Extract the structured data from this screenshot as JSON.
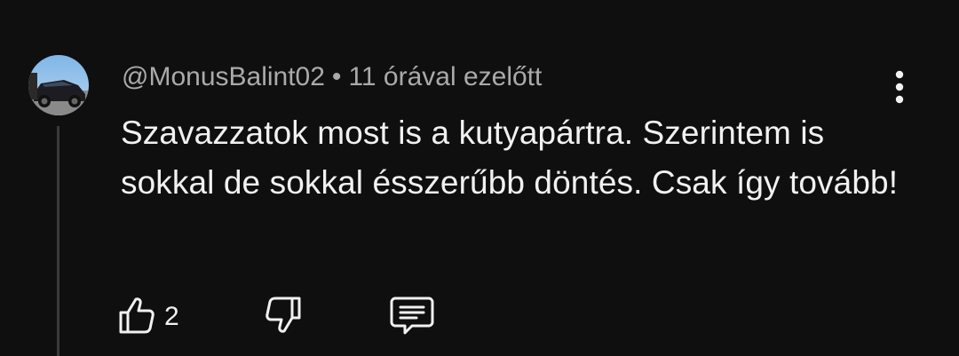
{
  "comment": {
    "author": "@MonusBalint02",
    "separator": "•",
    "time": "11 órával ezelőtt",
    "text": "Szavazzatok most is a kutyapártra. Szerintem is sokkal de sokkal ésszerűbb döntés. Csak így tovább!",
    "likes": "2"
  },
  "icons": {
    "avatar": "avatar-photo",
    "menu": "more-vertical-icon",
    "like": "thumb-up-icon",
    "dislike": "thumb-down-icon",
    "reply": "comment-reply-icon"
  },
  "colors": {
    "background": "#0f0f0f",
    "text": "#f1f1f1",
    "secondary_text": "#aaaaaa"
  }
}
